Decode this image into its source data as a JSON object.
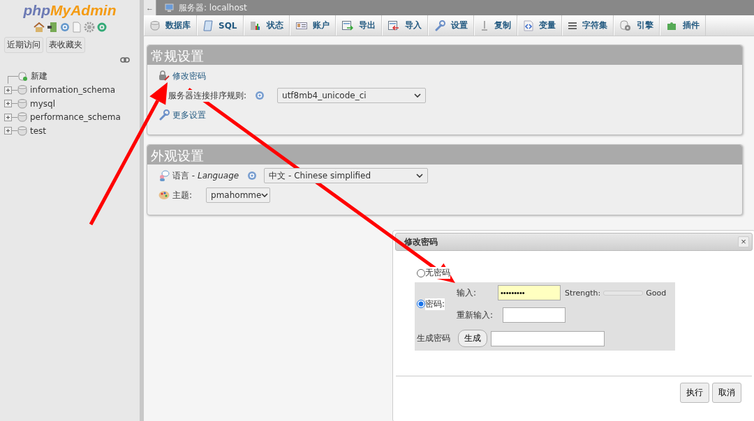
{
  "sidebar": {
    "logo_prefix": "php",
    "logo_name": "MyAdmin",
    "buttons": [
      "近期访问",
      "表收藏夹"
    ],
    "tree": [
      {
        "label": "新建",
        "kind": "new"
      },
      {
        "label": "information_schema",
        "kind": "db"
      },
      {
        "label": "mysql",
        "kind": "db"
      },
      {
        "label": "performance_schema",
        "kind": "db"
      },
      {
        "label": "test",
        "kind": "db"
      }
    ]
  },
  "topbar": {
    "collapse": "←",
    "title": "服务器: localhost"
  },
  "tabs": [
    {
      "label": "数据库",
      "kind": "db"
    },
    {
      "label": "SQL",
      "kind": "sql"
    },
    {
      "label": "状态",
      "kind": "status"
    },
    {
      "label": "账户",
      "kind": "account"
    },
    {
      "label": "导出",
      "kind": "export"
    },
    {
      "label": "导入",
      "kind": "import"
    },
    {
      "label": "设置",
      "kind": "settings"
    },
    {
      "label": "复制",
      "kind": "replication"
    },
    {
      "label": "变量",
      "kind": "variables"
    },
    {
      "label": "字符集",
      "kind": "charset"
    },
    {
      "label": "引擎",
      "kind": "engine"
    },
    {
      "label": "插件",
      "kind": "plugin"
    }
  ],
  "general_settings": {
    "title": "常规设置",
    "change_password": "修改密码",
    "collation_label": "服务器连接排序规则:",
    "collation_value": "utf8mb4_unicode_ci",
    "more_settings": "更多设置"
  },
  "appearance_settings": {
    "title": "外观设置",
    "language_label": "语言 - *Language*",
    "language_value": "中文 - Chinese simplified",
    "theme_label": "主题:",
    "theme_value": "pmahomme"
  },
  "dialog": {
    "title": "修改密码",
    "close": "×",
    "options": [
      {
        "label": "无密码",
        "selected": false
      },
      {
        "label": "密码:",
        "selected": true
      }
    ],
    "enter_label": "输入:",
    "enter_value": "•••••••••",
    "strength_label": "Strength:",
    "strength": {
      "level": 0
    },
    "strength_reading": "Good",
    "reenter_label": "重新输入:",
    "generate_label": "生成密码",
    "generate_button": "生成",
    "buttons": [
      "执行",
      "取消"
    ]
  }
}
